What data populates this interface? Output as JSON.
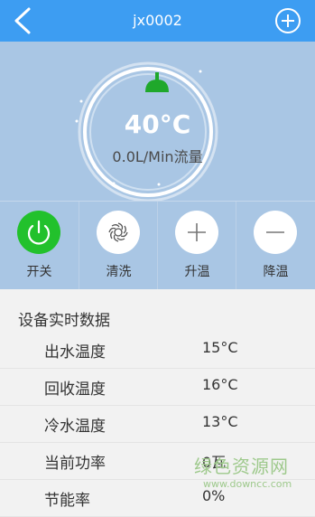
{
  "header": {
    "title": "jx0002"
  },
  "gauge": {
    "temperature": "40°C",
    "flow": "0.0L/Min流量"
  },
  "controls": [
    {
      "label": "开关"
    },
    {
      "label": "清洗"
    },
    {
      "label": "升温"
    },
    {
      "label": "降温"
    }
  ],
  "data_section": {
    "title": "设备实时数据",
    "rows": [
      {
        "label": "出水温度",
        "value": "15°C"
      },
      {
        "label": "回收温度",
        "value": "16°C"
      },
      {
        "label": "冷水温度",
        "value": "13°C"
      },
      {
        "label": "当前功率",
        "value": "0瓦"
      },
      {
        "label": "节能率",
        "value": "0%"
      }
    ]
  },
  "watermark": {
    "text": "绿色资源网",
    "url": "www.downcc.com"
  },
  "colors": {
    "header": "#3d9df2",
    "panel": "#a9c6e4",
    "power": "#22c12c",
    "shower": "#1fa82b"
  }
}
